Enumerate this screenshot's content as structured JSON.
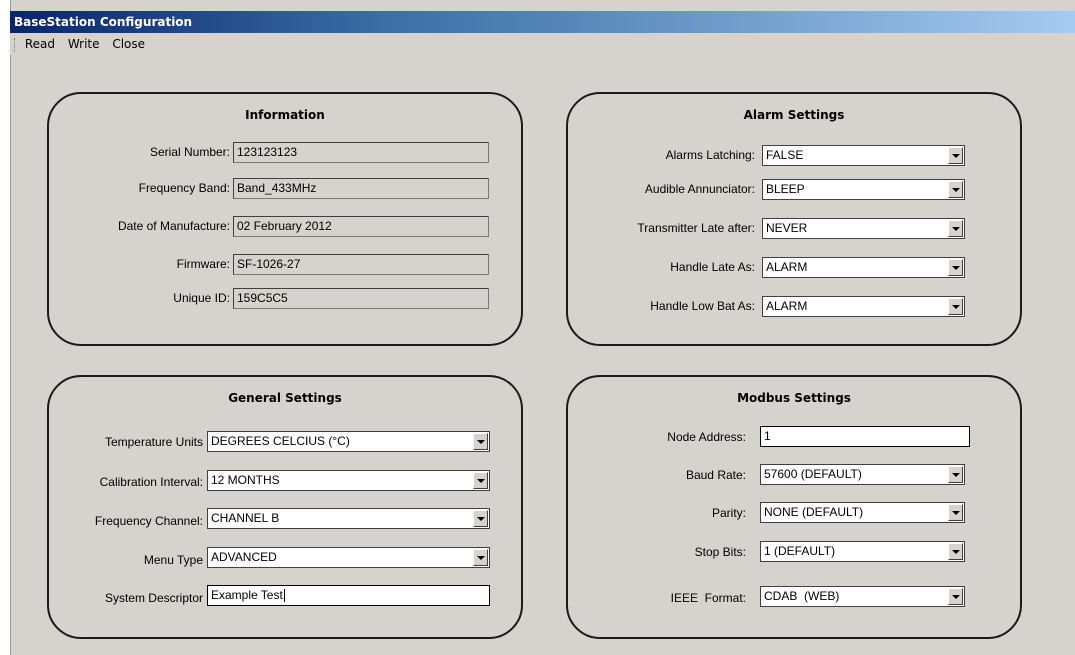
{
  "window": {
    "title": "BaseStation Configuration"
  },
  "menu": {
    "items": [
      "Read",
      "Write",
      "Close"
    ]
  },
  "information": {
    "title": "Information",
    "serial_number": {
      "label": "Serial Number:",
      "value": "123123123"
    },
    "frequency_band": {
      "label": "Frequency Band:",
      "value": "Band_433MHz"
    },
    "date_of_manufacture": {
      "label": "Date of Manufacture:",
      "value": "02 February 2012"
    },
    "firmware": {
      "label": "Firmware:",
      "value": "SF-1026-27"
    },
    "unique_id": {
      "label": "Unique ID:",
      "value": "159C5C5"
    }
  },
  "alarm": {
    "title": "Alarm Settings",
    "alarms_latching": {
      "label": "Alarms Latching:",
      "value": "FALSE"
    },
    "audible_annunciator": {
      "label": "Audible Annunciator:",
      "value": "BLEEP"
    },
    "transmitter_late": {
      "label": "Transmitter Late after:",
      "value": "NEVER"
    },
    "handle_late": {
      "label": "Handle Late As:",
      "value": "ALARM"
    },
    "handle_low_bat": {
      "label": "Handle Low Bat As:",
      "value": "ALARM"
    }
  },
  "general": {
    "title": "General Settings",
    "temperature_units": {
      "label": "Temperature Units",
      "value": "DEGREES CELCIUS (°C)"
    },
    "calibration_interval": {
      "label": "Calibration Interval:",
      "value": "12 MONTHS"
    },
    "frequency_channel": {
      "label": "Frequency Channel:",
      "value": "CHANNEL B"
    },
    "menu_type": {
      "label": "Menu Type",
      "value": "ADVANCED"
    },
    "system_descriptor": {
      "label": "System Descriptor",
      "value": "Example Test"
    }
  },
  "modbus": {
    "title": "Modbus Settings",
    "node_address": {
      "label": "Node Address:",
      "value": "1"
    },
    "baud_rate": {
      "label": "Baud Rate:",
      "value": "57600 (DEFAULT)"
    },
    "parity": {
      "label": "Parity:",
      "value": "NONE (DEFAULT)"
    },
    "stop_bits": {
      "label": "Stop Bits:",
      "value": "1 (DEFAULT)"
    },
    "ieee_format": {
      "label": "IEEE  Format:",
      "value": "CDAB  (WEB)"
    }
  }
}
